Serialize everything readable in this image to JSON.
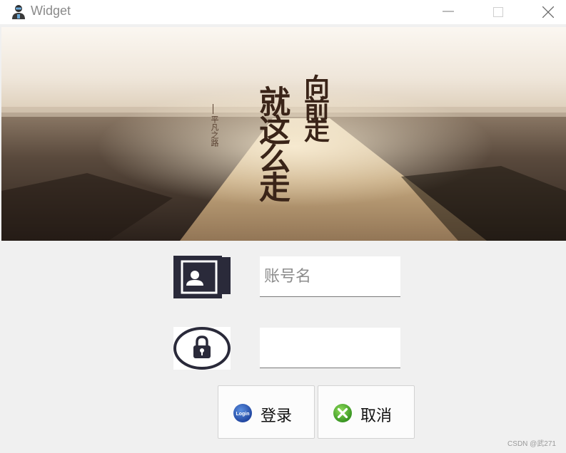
{
  "window": {
    "title": "Widget",
    "icon": "user-silhouette-icon",
    "controls": [
      "minimize-icon",
      "maximize-icon",
      "close-icon"
    ]
  },
  "banner": {
    "poster_text_large_1": "就这么走",
    "poster_text_large_2": "向前走",
    "poster_text_small": "平凡之路",
    "accent_colors": [
      "#e0cfb6",
      "#3a2418"
    ]
  },
  "form": {
    "account_icon": "contact-card-icon",
    "password_icon": "lock-icon",
    "account": {
      "value": "",
      "placeholder": "账号名"
    },
    "password": {
      "value": "",
      "placeholder": ""
    }
  },
  "buttons": {
    "login": {
      "label": "登录",
      "icon": "login-badge-icon",
      "icon_text": "Login"
    },
    "cancel": {
      "label": "取消",
      "icon": "green-x-icon"
    }
  },
  "watermark": "CSDN @武271"
}
